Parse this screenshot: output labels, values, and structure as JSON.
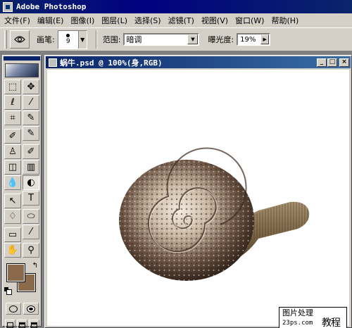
{
  "app": {
    "title": "Adobe Photoshop"
  },
  "menu": [
    "文件(F)",
    "编辑(E)",
    "图像(I)",
    "图层(L)",
    "选择(S)",
    "滤镜(T)",
    "视图(V)",
    "窗口(W)",
    "帮助(H)"
  ],
  "options": {
    "tool_icon": "dodge-tool-icon",
    "brush_label": "画笔:",
    "brush_size": "9",
    "range_label": "范围:",
    "range_value": "暗调",
    "exposure_label": "曝光度:",
    "exposure_value": "19%"
  },
  "document": {
    "title": "蜗牛.psd @ 100%(身,RGB)",
    "minimize": "_",
    "maximize": "□",
    "close": "×"
  },
  "toolbox": {
    "tools": [
      {
        "name": "marquee-tool-icon",
        "glyph": "⬚"
      },
      {
        "name": "move-tool-icon",
        "glyph": "✥"
      },
      {
        "name": "lasso-tool-icon",
        "glyph": "ℓ"
      },
      {
        "name": "magic-wand-tool-icon",
        "glyph": "⁄"
      },
      {
        "name": "crop-tool-icon",
        "glyph": "⌗"
      },
      {
        "name": "slice-tool-icon",
        "glyph": "✎"
      },
      {
        "name": "healing-brush-tool-icon",
        "glyph": "✐"
      },
      {
        "name": "brush-tool-icon",
        "glyph": "✎"
      },
      {
        "name": "clone-stamp-tool-icon",
        "glyph": "♙"
      },
      {
        "name": "history-brush-tool-icon",
        "glyph": "✐"
      },
      {
        "name": "eraser-tool-icon",
        "glyph": "◫"
      },
      {
        "name": "gradient-tool-icon",
        "glyph": "▥"
      },
      {
        "name": "blur-tool-icon",
        "glyph": "💧"
      },
      {
        "name": "dodge-tool-icon",
        "glyph": "◐"
      },
      {
        "name": "path-selection-tool-icon",
        "glyph": "↖"
      },
      {
        "name": "type-tool-icon",
        "glyph": "T"
      },
      {
        "name": "pen-tool-icon",
        "glyph": "♢"
      },
      {
        "name": "ellipse-tool-icon",
        "glyph": "⬭"
      },
      {
        "name": "notes-tool-icon",
        "glyph": "▭"
      },
      {
        "name": "eyedropper-tool-icon",
        "glyph": "⁄"
      },
      {
        "name": "hand-tool-icon",
        "glyph": "✋"
      },
      {
        "name": "zoom-tool-icon",
        "glyph": "⚲"
      }
    ],
    "foreground_color": "#8a6a4a",
    "background_color": "#8a6a4a"
  },
  "watermark": {
    "line1": "图片处理",
    "line2": "23ps.com",
    "line3": "教程网"
  }
}
